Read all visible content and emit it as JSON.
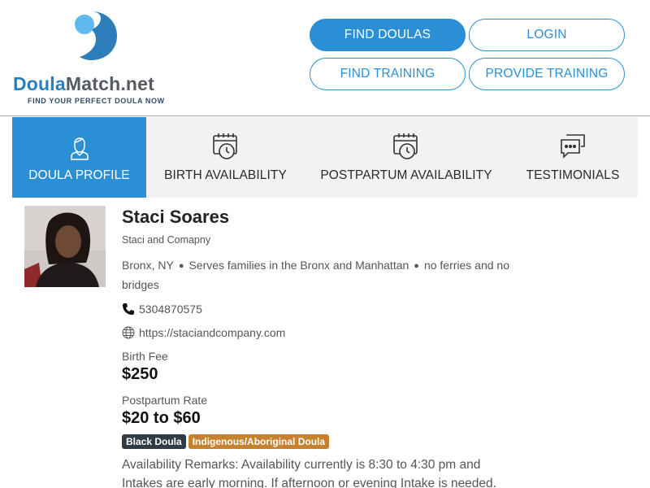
{
  "header": {
    "logo": {
      "name_part1": "Doula",
      "name_part2": "Match.net",
      "tagline": "FIND YOUR PERFECT DOULA NOW"
    },
    "nav": {
      "find_doulas": "FIND DOULAS",
      "login": "LOGIN",
      "find_training": "FIND TRAINING",
      "provide_training": "PROVIDE TRAINING"
    }
  },
  "tabs": [
    {
      "label": "DOULA PROFILE",
      "icon": "doula-person-icon",
      "active": true
    },
    {
      "label": "BIRTH AVAILABILITY",
      "icon": "calendar-clock-icon",
      "active": false
    },
    {
      "label": "POSTPARTUM AVAILABILITY",
      "icon": "calendar-clock-icon",
      "active": false
    },
    {
      "label": "TESTIMONIALS",
      "icon": "chat-bubbles-icon",
      "active": false
    }
  ],
  "profile": {
    "name": "Staci Soares",
    "company": "Staci and Comapny",
    "location": {
      "city": "Bronx, NY",
      "area": "Serves families in the Bronx and Manhattan",
      "note": "no ferries and no bridges"
    },
    "phone": "5304870575",
    "website": "https://staciandcompany.com",
    "birth_fee_label": "Birth Fee",
    "birth_fee": "$250",
    "postpartum_label": "Postpartum Rate",
    "postpartum_rate": "$20 to $60",
    "badges": [
      "Black Doula",
      "Indigenous/Aboriginal Doula"
    ],
    "remarks": "Availability Remarks: Availability currently is 8:30 to 4:30 pm and Intakes are early morning. If afternoon or evening Intake is needed."
  },
  "colors": {
    "brand_blue": "#2b8fd6",
    "badge_dark": "#2f3b45",
    "badge_orange": "#c5812c"
  }
}
